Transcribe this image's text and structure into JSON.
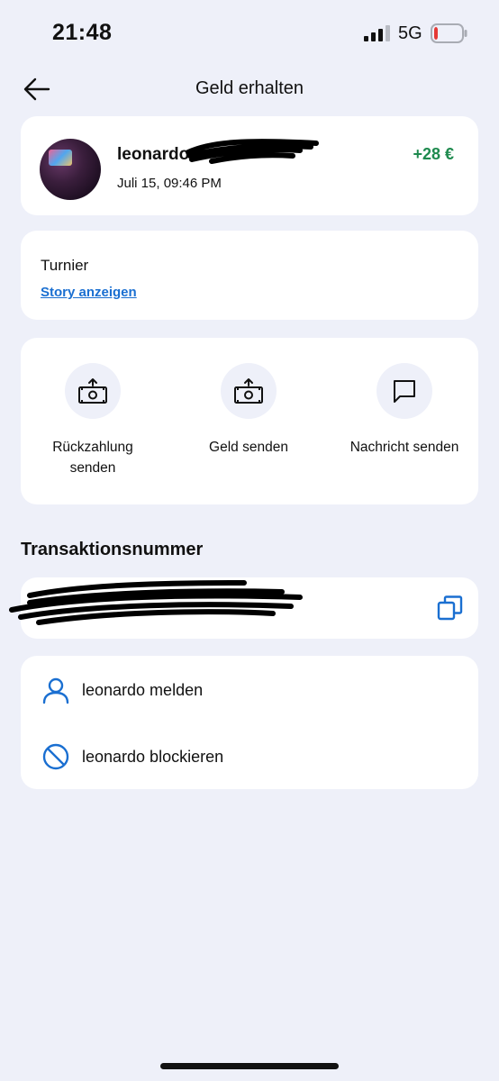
{
  "status_bar": {
    "time": "21:48",
    "network": "5G",
    "battery_level": 0.15,
    "battery_color": "#e53935"
  },
  "nav": {
    "back_icon": "arrow-left-icon",
    "title": "Geld erhalten"
  },
  "sender": {
    "name": "leonardo",
    "date": "Juli 15, 09:46 PM",
    "amount": "+28 €",
    "amount_color": "#1e8a4e"
  },
  "note": {
    "text": "Turnier",
    "link": "Story anzeigen"
  },
  "actions": [
    {
      "icon": "money-send-icon",
      "label_line1": "Rückzahlung",
      "label_line2": "senden"
    },
    {
      "icon": "money-send-icon",
      "label_line1": "Geld senden",
      "label_line2": ""
    },
    {
      "icon": "chat-bubble-icon",
      "label_line1": "Nachricht senden",
      "label_line2": ""
    }
  ],
  "transaction": {
    "section_title": "Transaktionsnummer",
    "copy_icon": "copy-icon"
  },
  "menu": [
    {
      "icon": "person-icon",
      "label": "leonardo melden"
    },
    {
      "icon": "block-icon",
      "label": "leonardo blockieren"
    }
  ],
  "colors": {
    "background": "#eef0f9",
    "accent": "#1a6fd1",
    "card": "#ffffff"
  }
}
